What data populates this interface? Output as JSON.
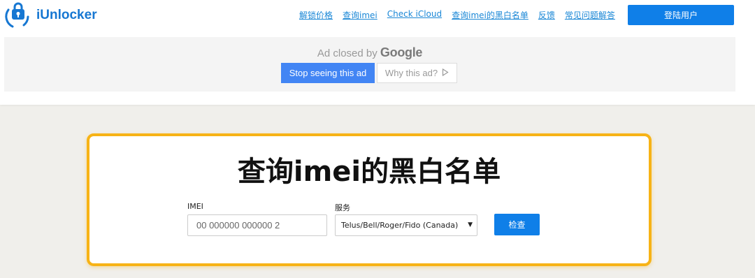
{
  "colors": {
    "brand": "#1677d2",
    "primary_button": "#0f7fe8",
    "ad_button": "#4285f4",
    "card_border": "#f7b316",
    "page_background": "#f0efeb"
  },
  "header": {
    "logo_text": "iUnlocker",
    "logo_icon": "padlock-logo-icon",
    "nav": [
      {
        "label": "解锁价格"
      },
      {
        "label": "查询imei"
      },
      {
        "label": "Check iCloud"
      },
      {
        "label": "查询imei的黑白名单"
      },
      {
        "label": "反馈"
      },
      {
        "label": "常见问题解答"
      }
    ],
    "login_label": "登陆用户"
  },
  "ad": {
    "closed_prefix": "Ad closed by",
    "closed_brand": "Google",
    "stop_label": "Stop seeing this ad",
    "why_label": "Why this ad?",
    "why_icon": "play-triangle-icon"
  },
  "form": {
    "title": "查询imei的黑白名单",
    "imei_label": "IMEI",
    "imei_placeholder": "00 000000 000000 2",
    "service_label": "服务",
    "service_selected": "Telus/Bell/Roger/Fido (Canada)",
    "service_arrow": "▼",
    "check_label": "检查"
  }
}
